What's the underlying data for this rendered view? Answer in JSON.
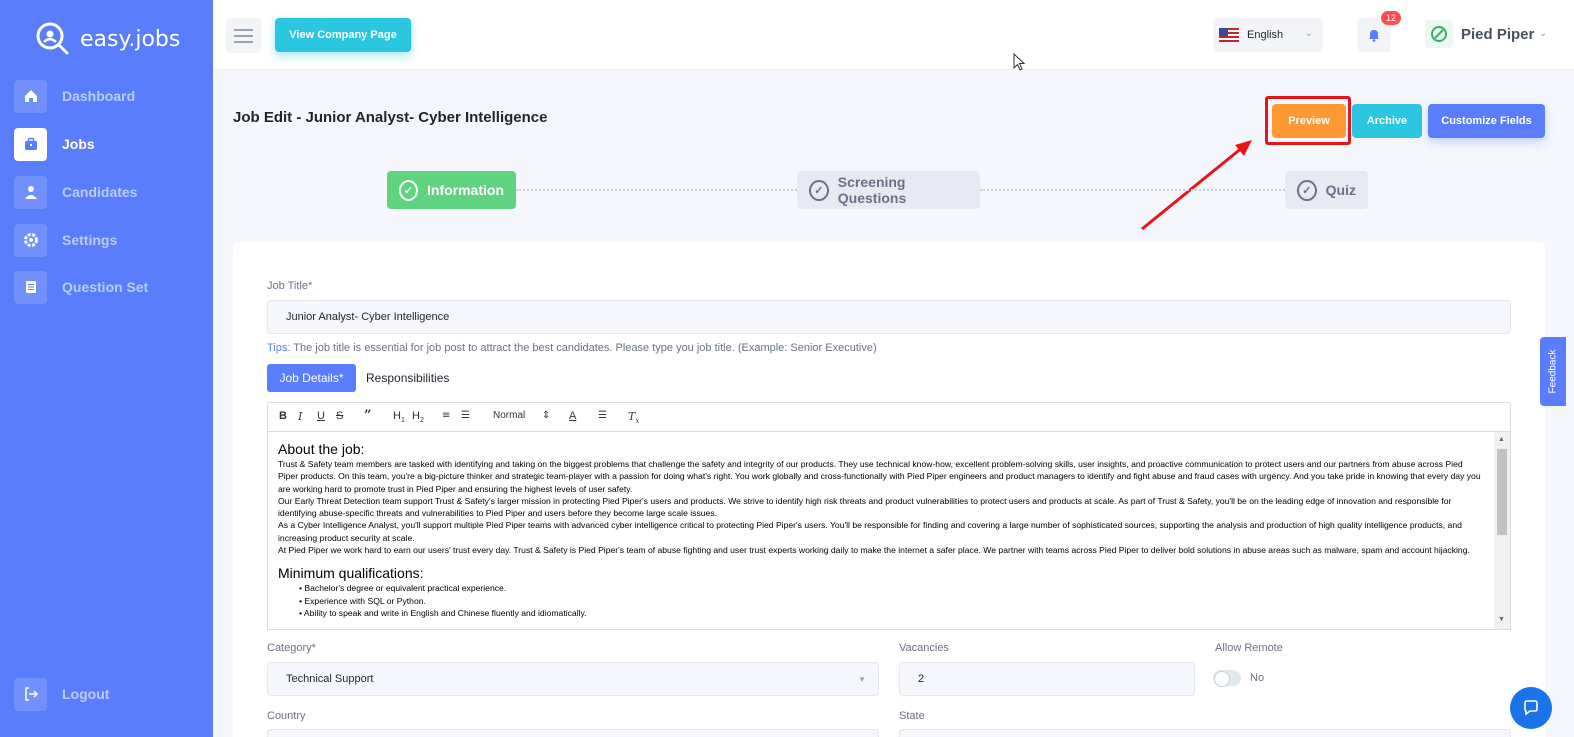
{
  "app": {
    "name": "easy.jobs"
  },
  "sidebar": {
    "items": [
      {
        "label": "Dashboard",
        "icon": "home-icon"
      },
      {
        "label": "Jobs",
        "icon": "briefcase-icon",
        "active": true
      },
      {
        "label": "Candidates",
        "icon": "user-icon"
      },
      {
        "label": "Settings",
        "icon": "gear-icon"
      },
      {
        "label": "Question Set",
        "icon": "document-icon"
      }
    ],
    "logout_label": "Logout"
  },
  "topbar": {
    "view_company_label": "View Company Page",
    "language": "English",
    "notification_count": "12",
    "company_name": "Pied Piper"
  },
  "page": {
    "title": "Job Edit - Junior Analyst- Cyber Intelligence",
    "preview_label": "Preview",
    "archive_label": "Archive",
    "customize_label": "Customize Fields"
  },
  "steps": {
    "information": "Information",
    "screening": "Screening Questions",
    "quiz": "Quiz"
  },
  "form": {
    "job_title_label": "Job Title*",
    "job_title_value": "Junior Analyst-  Cyber Intelligence",
    "tips_prefix": "Tips:",
    "tips_text": " The job title is essential for job post to attract the best candidates. Please type you job title. (Example: Senior Executive)",
    "tab_details": "Job Details*",
    "tab_responsibilities": "Responsibilities",
    "toolbar_heading_select": "Normal",
    "editor": {
      "heading1": "About the job:",
      "para1": "Trust & Safety team members are tasked with identifying and taking on the biggest problems that challenge the safety and integrity of our products. They use technical know-how, excellent problem-solving skills, user insights, and proactive communication to protect users and our partners from abuse across Pied Piper products. On this team, you're a big-picture thinker and strategic team-player with a passion for doing what's right. You work globally and cross-functionally with Pied Piper engineers and product managers to identify and fight abuse and fraud cases with urgency. And you take pride in knowing that every day you are working hard to promote trust in Pied Piper and ensuring the highest levels of user safety.",
      "para2": "Our Early Threat Detection team support Trust & Safety's larger mission in protecting Pied Piper's users and products. We strive to identify high risk threats and product vulnerabilities to protect users and products at scale. As part of Trust & Safety, you'll be on the leading edge of innovation and responsible for identifying abuse-specific threats and vulnerabilities to Pied Piper and users before they become large scale issues.",
      "para3": "As a Cyber Intelligence Analyst, you'll support multiple Pied Piper teams with advanced cyber intelligence critical to protecting Pied Piper's users. You'll be responsible for finding and covering a large number of sophisticated sources, supporting the analysis and production of high quality intelligence products, and increasing product security at scale.",
      "para4": "At Pied Piper we work hard to earn our users' trust every day. Trust & Safety is Pied Piper's team of abuse fighting and user trust experts working daily to make the internet a safer place. We partner with teams across Pied Piper to deliver bold solutions in abuse areas such as malware, spam and account hijacking.",
      "heading2": "Minimum qualifications:",
      "bullets": [
        "Bachelor's degree or equivalent practical experience.",
        "Experience with SQL or Python.",
        "Ability to speak and write in English and Chinese fluently and idiomatically."
      ]
    },
    "category_label": "Category*",
    "category_value": "Technical Support",
    "vacancies_label": "Vacancies",
    "vacancies_value": "2",
    "remote_label": "Allow Remote",
    "remote_value": "No",
    "country_label": "Country",
    "state_label": "State"
  },
  "widgets": {
    "feedback_label": "Feedback"
  },
  "colors": {
    "sidebar": "#597dfc",
    "preview": "#ff9933",
    "archive": "#2bc6e0",
    "customize": "#597dfc",
    "step_active": "#5fd37f",
    "annotation": "#e8141b"
  }
}
